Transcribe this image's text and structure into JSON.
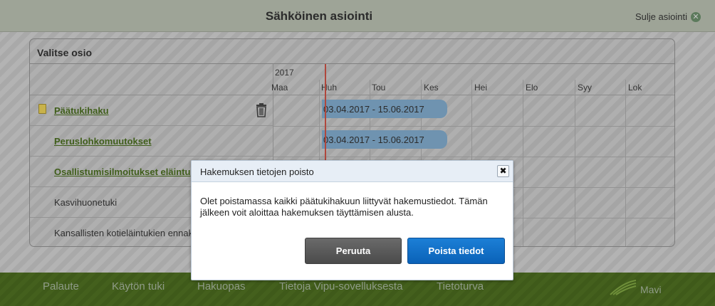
{
  "window": {
    "title": "Sähköinen asiointi",
    "close_label": "Sulje asiointi"
  },
  "panel": {
    "title": "Valitse osio",
    "timeline": {
      "year": "2017",
      "months": [
        "Maa",
        "Huh",
        "Tou",
        "Kes",
        "Hei",
        "Elo",
        "Syy",
        "Lok"
      ]
    },
    "rows": [
      {
        "label": "Päätukihaku",
        "link": true,
        "date_range": "03.04.2017 - 15.06.2017"
      },
      {
        "label": "Peruslohkomuutokset",
        "link": true,
        "date_range": "03.04.2017 - 15.06.2017"
      },
      {
        "label": "Osallistumisilmoitukset eläintu",
        "link": true
      },
      {
        "label": "Kasvihuonetuki",
        "link": false
      },
      {
        "label": "Kansallisten kotieläintukien ennak",
        "link": false
      }
    ]
  },
  "footer": {
    "links": [
      "Palaute",
      "Käytön tuki",
      "Hakuopas",
      "Tietoja Vipu-sovelluksesta",
      "Tietoturva"
    ],
    "logo_text": "Mavi"
  },
  "dialog": {
    "title": "Hakemuksen tietojen poisto",
    "message": "Olet poistamassa kaikki päätukihakuun liittyvät hakemustiedot. Tämän jälkeen voit aloittaa hakemuksen täyttämisen alusta.",
    "cancel_label": "Peruuta",
    "confirm_label": "Poista tiedot"
  },
  "colors": {
    "accent_blue": "#0a62b8",
    "footer_green": "#3f5a1a",
    "bar_blue": "#6f93b0",
    "today_line": "#b0473c"
  }
}
